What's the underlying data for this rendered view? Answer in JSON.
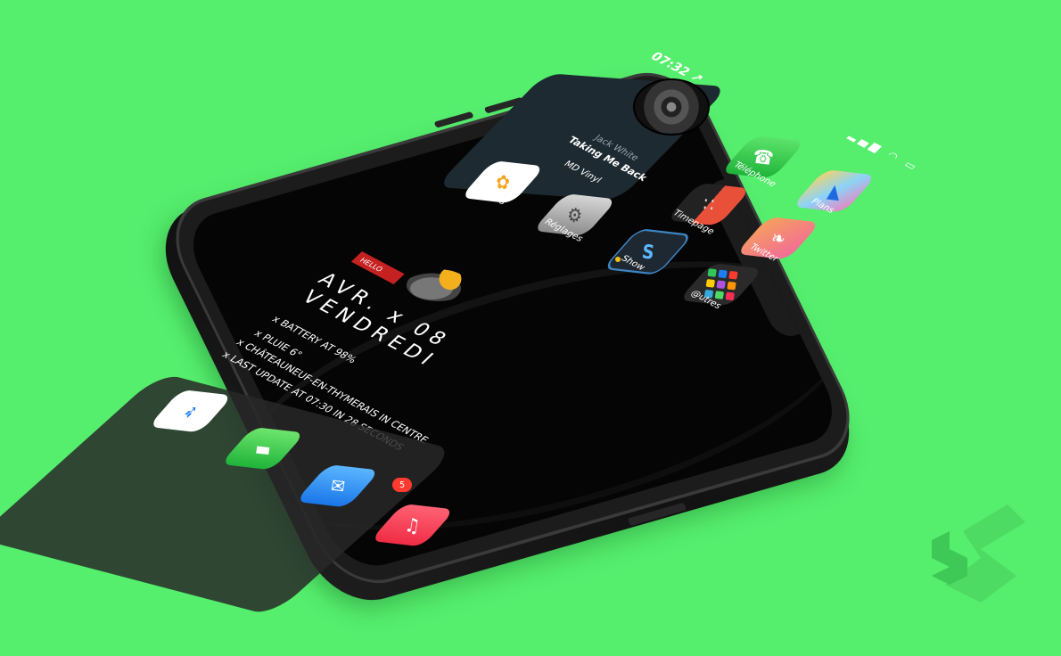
{
  "status_bar": {
    "time": "07:32 ↗",
    "icons": "▂▄▆ ◠ ▭"
  },
  "music_widget": {
    "artist": "Jack White",
    "song": "Taking Me Back",
    "label": "MD Vinyl"
  },
  "apps": [
    {
      "label": "Téléphone",
      "icon": "phone-icon",
      "glyph": "☎"
    },
    {
      "label": "Plans",
      "icon": "maps-icon",
      "glyph": "▲"
    },
    {
      "label": "Photos",
      "icon": "photos-icon",
      "glyph": "✿"
    },
    {
      "label": "Réglages",
      "icon": "settings-icon",
      "glyph": "⚙"
    },
    {
      "label": "Timepage",
      "icon": "timepage-icon",
      "glyph": "∷"
    },
    {
      "label": "Twitter",
      "icon": "twitter-icon",
      "glyph": "❧"
    },
    {
      "label": "Show",
      "icon": "show-icon",
      "glyph": "S"
    },
    {
      "label": "@utres",
      "icon": "folder-icon",
      "glyph": ""
    }
  ],
  "weather_widget": {
    "badge": "HELLO",
    "date_line1": "AVR. x 08",
    "date_line2": "VENDREDI",
    "lines": [
      "x BATTERY AT 98%",
      "x PLUIE  6°",
      "x CHÂTEAUNEUF-EN-THYMERAIS IN CENTRE",
      "x LAST UPDATE AT 07:30  IN 28 SECONDS"
    ]
  },
  "dock": {
    "apps": [
      {
        "name": "Safari",
        "icon": "safari-icon",
        "glyph": "➶"
      },
      {
        "name": "Messages",
        "icon": "messages-icon",
        "glyph": "▬"
      },
      {
        "name": "Mail",
        "icon": "mail-icon",
        "glyph": "✉"
      },
      {
        "name": "Music",
        "icon": "music-icon",
        "glyph": "♫"
      }
    ],
    "mail_badge": "5"
  },
  "colors": {
    "background": "#55ee6d",
    "screen": "#050505",
    "badge": "#ff3b30",
    "hello": "#c62121"
  }
}
